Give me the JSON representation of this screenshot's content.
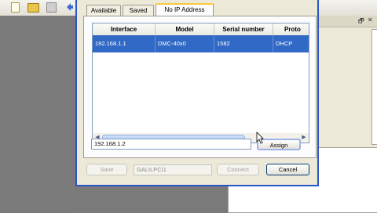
{
  "toolbar": {
    "icons": [
      "new-file-icon",
      "open-folder-icon",
      "save-disk-icon",
      "arrow-icon"
    ]
  },
  "right_panel": {
    "restore_glyph": "🗗",
    "close_glyph": "✕"
  },
  "dialog": {
    "tabs": {
      "available": "Available",
      "saved": "Saved",
      "no_ip_address": "No IP Address"
    },
    "table": {
      "columns": [
        "Interface",
        "Model",
        "Serial number",
        "Proto"
      ],
      "rows": [
        [
          "192.168.1.1",
          "DMC-40x0",
          "1582",
          "DHCP"
        ]
      ]
    },
    "ip_input": {
      "value": "192.168.1.2"
    },
    "assign_label": "Assign",
    "save_label": "Save",
    "device_name": "GALILPCI1",
    "connect_label": "Connect",
    "cancel_label": "Cancel"
  },
  "colors": {
    "selection": "#3169c6",
    "dialog_border": "#2a55c8",
    "active_tab_accent": "#ffc83c",
    "window_bg": "#ece9d8"
  }
}
